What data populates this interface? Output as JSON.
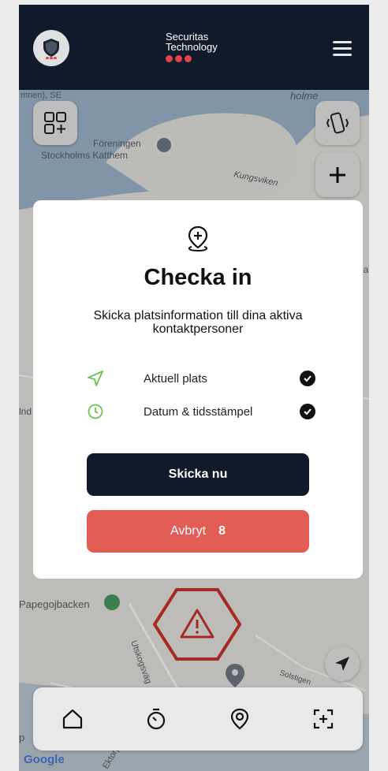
{
  "header": {
    "brand_line1": "Securitas",
    "brand_line2": "Technology"
  },
  "map": {
    "labels": {
      "top_left": "mnen), SE",
      "top_right": "holme",
      "poi": "Föreningen",
      "poi2": "Stockholms Katthem",
      "water": "Kungsviken",
      "left_edge": "lnd",
      "right_edge": "lat",
      "papego": "Papegojbacken",
      "utsko": "Utskogsväg",
      "solsti": "Solstigen",
      "ekto": "Ektorp",
      "p_left": "p",
      "google": "Google"
    }
  },
  "modal": {
    "title": "Checka in",
    "subtitle": "Skicka platsinformation till dina aktiva kontaktpersoner",
    "items": [
      {
        "label": "Aktuell plats",
        "icon": "location-arrow-icon",
        "checked": true
      },
      {
        "label": "Datum & tidsstämpel",
        "icon": "clock-icon",
        "checked": true
      }
    ],
    "send_label": "Skicka nu",
    "cancel_label": "Avbryt",
    "cancel_countdown": "8"
  },
  "nav": {
    "items": [
      "home-icon",
      "timer-icon",
      "location-pin-icon",
      "check-in-scan-icon"
    ]
  },
  "colors": {
    "header_bg": "#0f1b2a",
    "accent_red": "#e2434b",
    "cancel_red": "#e25d55",
    "green_icon": "#6cc24a",
    "map_bg": "#e7e6e2",
    "water": "#9fb5cc"
  }
}
